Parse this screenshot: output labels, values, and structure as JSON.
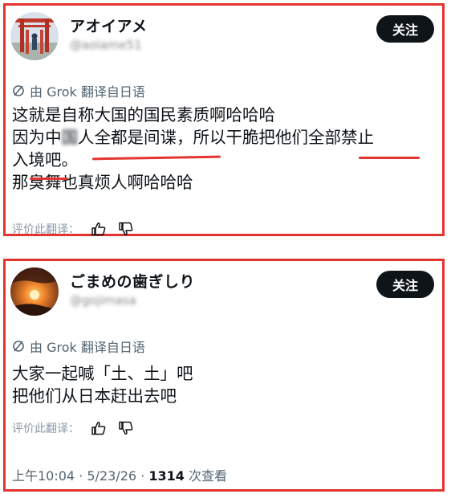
{
  "posts": [
    {
      "name": "アオイアメ",
      "handle": "@aoiame51",
      "follow_label": "关注",
      "translate_label": "由 Grok 翻译自日语",
      "lines": [
        {
          "segments": [
            "这就是自称大国的国民素质啊哈哈哈"
          ]
        },
        {
          "segments": [
            "因为中",
            "国",
            "人全都是间谍，所以干脆把他们全部禁止"
          ]
        },
        {
          "segments": [
            "入境吧。"
          ]
        },
        {
          "segments": [
            "那臭舞也真烦人啊哈哈哈"
          ]
        }
      ],
      "rate_label": "评价此翻译："
    },
    {
      "name": "ごまめの歯ぎしり",
      "handle": "@gojimasa",
      "follow_label": "关注",
      "translate_label": "由 Grok 翻译自日语",
      "lines": [
        {
          "segments": [
            "大家一起喊「土、土」吧"
          ]
        },
        {
          "segments": [
            "把他们从日本赶出去吧"
          ]
        }
      ],
      "rate_label": "评价此翻译：",
      "meta": {
        "time": "上午10:04",
        "sep1": "·",
        "date": "5/23/26",
        "sep2": "·",
        "views_count": "1314",
        "views_label": "次查看"
      }
    }
  ],
  "icons": {
    "grok": "grok-icon",
    "thumbs_up": "thumbs-up-icon",
    "thumbs_down": "thumbs-down-icon"
  },
  "colors": {
    "highlight_border": "#e3342f",
    "button_bg": "#0f1419",
    "muted_text": "#536471"
  }
}
